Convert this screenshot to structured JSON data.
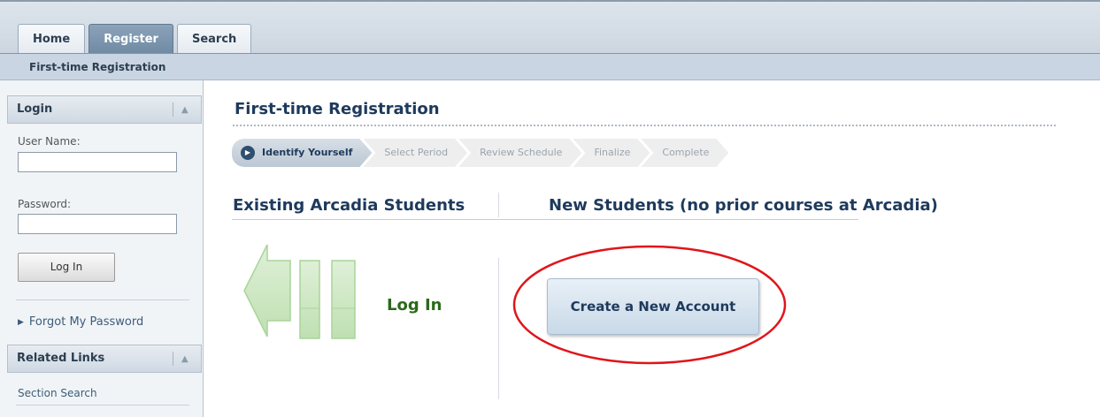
{
  "top_tabs": [
    {
      "label": "Home",
      "active": false
    },
    {
      "label": "Register",
      "active": true
    },
    {
      "label": "Search",
      "active": false
    }
  ],
  "subnav": {
    "label": "First-time Registration"
  },
  "sidebar": {
    "login_panel": {
      "title": "Login",
      "collapse_icon": "caret-up-icon",
      "username_label": "User Name:",
      "username_value": "",
      "password_label": "Password:",
      "password_value": "",
      "login_button": "Log In",
      "forgot_link": "Forgot My Password"
    },
    "related_links_panel": {
      "title": "Related Links",
      "collapse_icon": "caret-up-icon",
      "items": [
        "Section Search"
      ]
    }
  },
  "main": {
    "title": "First-time Registration",
    "steps": [
      {
        "label": "Identify Yourself",
        "active": true
      },
      {
        "label": "Select Period",
        "active": false
      },
      {
        "label": "Review Schedule",
        "active": false
      },
      {
        "label": "Finalize",
        "active": false
      },
      {
        "label": "Complete",
        "active": false
      }
    ],
    "existing": {
      "heading": "Existing Arcadia Students",
      "login_label": "Log In"
    },
    "new": {
      "heading": "New Students (no prior courses at Arcadia)",
      "create_button": "Create a New Account"
    }
  },
  "colors": {
    "accent_green": "#2a6a1a",
    "highlight_red": "#e0151b",
    "heading_blue": "#1e3a5c"
  }
}
